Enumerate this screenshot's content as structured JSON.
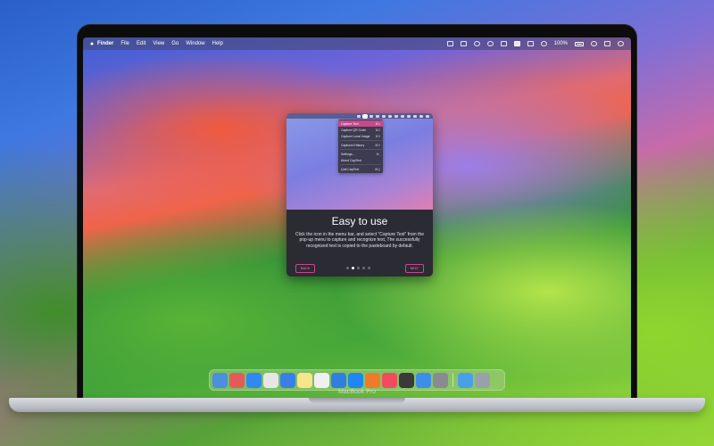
{
  "laptop": {
    "label": "MacBook Pro"
  },
  "menubar": {
    "app_name": "Finder",
    "items": [
      "File",
      "Edit",
      "View",
      "Go",
      "Window",
      "Help"
    ],
    "battery_text": "100%"
  },
  "popup_menu": {
    "items": [
      {
        "label": "Capture Text",
        "shortcut": "⌘1",
        "highlighted": true
      },
      {
        "label": "Capture QR Code",
        "shortcut": "⌘2"
      },
      {
        "label": "Capture Local Image",
        "shortcut": "⌘3"
      },
      {
        "label": "Captured History",
        "shortcut": "⌘H"
      },
      {
        "label": "Settings...",
        "shortcut": "⌘,"
      },
      {
        "label": "About CapText",
        "shortcut": ""
      },
      {
        "label": "Quit CapText",
        "shortcut": "⌘Q"
      }
    ]
  },
  "onboarding": {
    "title": "Easy to use",
    "description": "Click the icon in the menu bar, and select \"Capture Text\" from the pop-up menu to capture and recognize text, The successfully recognized text is copied to the pasteboard by default.",
    "back_label": "BACK",
    "next_label": "NEXT",
    "pages_total": 5,
    "page_current": 2
  },
  "dock": {
    "apps": [
      {
        "name": "finder-icon",
        "color": "#4a8fe0"
      },
      {
        "name": "launchpad-icon",
        "color": "#e35a5a"
      },
      {
        "name": "safari-icon",
        "color": "#2f89f0"
      },
      {
        "name": "chrome-icon",
        "color": "#e6e6e6"
      },
      {
        "name": "mail-icon",
        "color": "#3a7ee8"
      },
      {
        "name": "notes-icon",
        "color": "#f6e58a"
      },
      {
        "name": "photos-icon",
        "color": "#f0f0f0"
      },
      {
        "name": "captext-icon",
        "color": "#2f7fe0"
      },
      {
        "name": "app-store-icon",
        "color": "#1f86f2"
      },
      {
        "name": "books-icon",
        "color": "#f07a2a"
      },
      {
        "name": "music-icon",
        "color": "#f24a5e"
      },
      {
        "name": "calculator-icon",
        "color": "#3a3a3a"
      },
      {
        "name": "screen-capture-icon",
        "color": "#3c8ee8"
      },
      {
        "name": "system-settings-icon",
        "color": "#8a8a92"
      },
      {
        "name": "downloads-folder-icon",
        "color": "#4aa0e8"
      },
      {
        "name": "trash-icon",
        "color": "#9aa0a8"
      }
    ]
  }
}
